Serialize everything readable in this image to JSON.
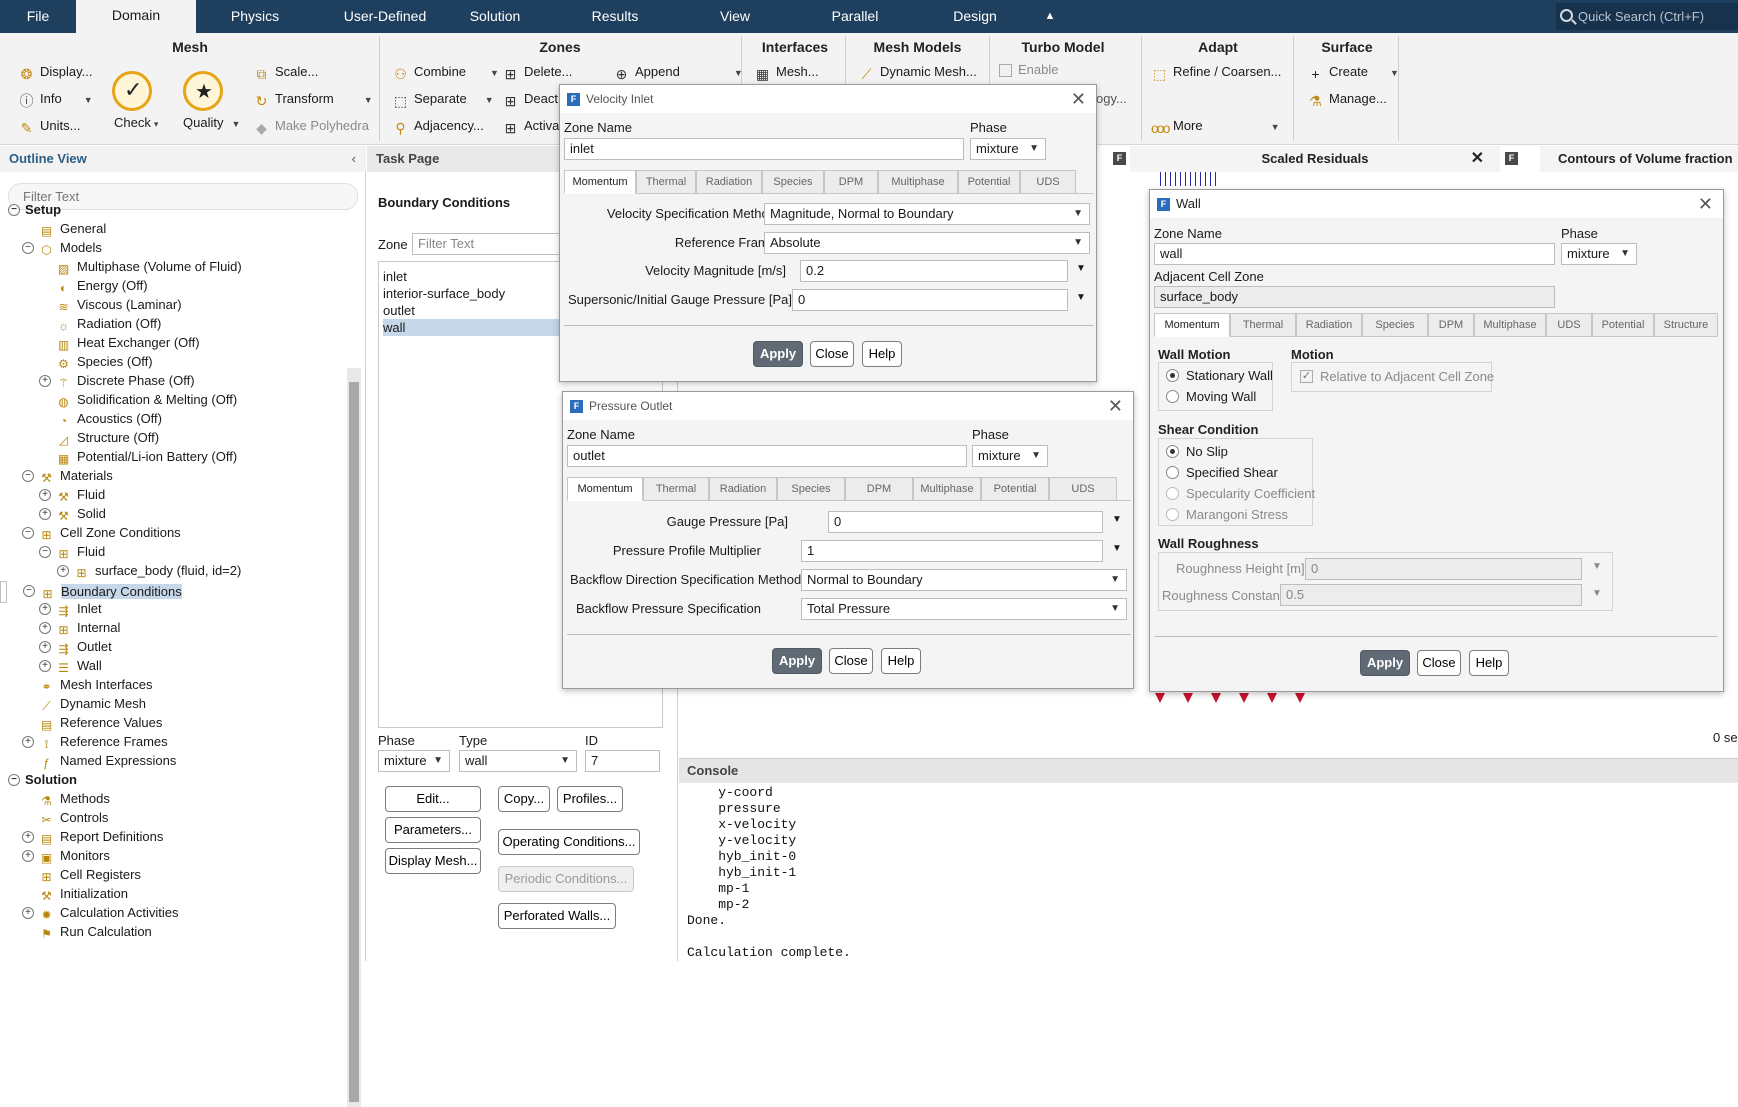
{
  "menubar": {
    "items": [
      "File",
      "Domain",
      "Physics",
      "User-Defined",
      "Solution",
      "Results",
      "View",
      "Parallel",
      "Design"
    ],
    "active": "Domain",
    "quick_search": "Quick Search (Ctrl+F)"
  },
  "ribbon": {
    "mesh": {
      "title": "Mesh",
      "display": "Display...",
      "info": "Info",
      "units": "Units...",
      "check": "Check",
      "quality": "Quality",
      "scale": "Scale...",
      "transform": "Transform",
      "make_polyhedra": "Make Polyhedra"
    },
    "zones": {
      "title": "Zones",
      "combine": "Combine",
      "separate": "Separate",
      "adjacency": "Adjacency...",
      "delete": "Delete...",
      "deact": "Deact",
      "activ": "Activa",
      "append": "Append"
    },
    "interfaces": {
      "title": "Interfaces",
      "mesh": "Mesh..."
    },
    "mesh_models": {
      "title": "Mesh Models",
      "dynamic_mesh": "Dynamic Mesh..."
    },
    "turbo_model": {
      "title": "Turbo Model",
      "enable": "Enable",
      "ogy": "ogy..."
    },
    "adapt": {
      "title": "Adapt",
      "refine": "Refine / Coarsen...",
      "more": "More"
    },
    "surface": {
      "title": "Surface",
      "create": "Create",
      "manage": "Manage..."
    }
  },
  "outline": {
    "title": "Outline View",
    "filter_placeholder": "Filter Text",
    "tree": [
      "Setup",
      "General",
      "Models",
      "Multiphase (Volume of Fluid)",
      "Energy (Off)",
      "Viscous (Laminar)",
      "Radiation (Off)",
      "Heat Exchanger (Off)",
      "Species (Off)",
      "Discrete Phase (Off)",
      "Solidification & Melting (Off)",
      "Acoustics (Off)",
      "Structure (Off)",
      "Potential/Li-ion Battery (Off)",
      "Materials",
      "Fluid",
      "Solid",
      "Cell Zone Conditions",
      "Fluid",
      "surface_body (fluid, id=2)",
      "Boundary Conditions",
      "Inlet",
      "Internal",
      "Outlet",
      "Wall",
      "Mesh Interfaces",
      "Dynamic Mesh",
      "Reference Values",
      "Reference Frames",
      "Named Expressions",
      "Solution",
      "Methods",
      "Controls",
      "Report Definitions",
      "Monitors",
      "Cell Registers",
      "Initialization",
      "Calculation Activities",
      "Run Calculation"
    ]
  },
  "task_page": {
    "title": "Task Page",
    "heading": "Boundary Conditions",
    "zone_label": "Zone",
    "zone_filter_placeholder": "Filter Text",
    "zones": [
      "inlet",
      "interior-surface_body",
      "outlet",
      "wall"
    ],
    "selected_zone": "wall",
    "phase_label": "Phase",
    "phase_value": "mixture",
    "type_label": "Type",
    "type_value": "wall",
    "id_label": "ID",
    "id_value": "7",
    "buttons": {
      "edit": "Edit...",
      "copy": "Copy...",
      "profiles": "Profiles...",
      "parameters": "Parameters...",
      "operating": "Operating Conditions...",
      "display_mesh": "Display Mesh...",
      "periodic": "Periodic Conditions...",
      "perforated": "Perforated Walls..."
    }
  },
  "graphics": {
    "tab1": "Scaled Residuals",
    "tab2": "Contours of Volume fraction",
    "time_fragment": "0 se"
  },
  "console": {
    "title": "Console",
    "lines": [
      "    y-coord",
      "    pressure",
      "    x-velocity",
      "    y-velocity",
      "    hyb_init-0",
      "    hyb_init-1",
      "    mp-1",
      "    mp-2",
      "Done.",
      "",
      "Calculation complete."
    ]
  },
  "velocity_inlet": {
    "title": "Velocity Inlet",
    "zone_name_label": "Zone Name",
    "zone_name": "inlet",
    "phase_label": "Phase",
    "phase": "mixture",
    "tabs": [
      "Momentum",
      "Thermal",
      "Radiation",
      "Species",
      "DPM",
      "Multiphase",
      "Potential",
      "UDS"
    ],
    "vel_spec_label": "Velocity Specification Method",
    "vel_spec": "Magnitude, Normal to Boundary",
    "ref_frame_label": "Reference Frame",
    "ref_frame": "Absolute",
    "vel_mag_label": "Velocity Magnitude [m/s]",
    "vel_mag": "0.2",
    "supersonic_label": "Supersonic/Initial Gauge Pressure [Pa]",
    "supersonic": "0",
    "apply": "Apply",
    "close": "Close",
    "help": "Help"
  },
  "pressure_outlet": {
    "title": "Pressure Outlet",
    "zone_name_label": "Zone Name",
    "zone_name": "outlet",
    "phase_label": "Phase",
    "phase": "mixture",
    "tabs": [
      "Momentum",
      "Thermal",
      "Radiation",
      "Species",
      "DPM",
      "Multiphase",
      "Potential",
      "UDS"
    ],
    "gauge_label": "Gauge Pressure [Pa]",
    "gauge": "0",
    "multiplier_label": "Pressure Profile Multiplier",
    "multiplier": "1",
    "backflow_dir_label": "Backflow Direction Specification Method",
    "backflow_dir": "Normal to Boundary",
    "backflow_press_label": "Backflow Pressure Specification",
    "backflow_press": "Total Pressure",
    "apply": "Apply",
    "close": "Close",
    "help": "Help"
  },
  "wall": {
    "title": "Wall",
    "zone_name_label": "Zone Name",
    "zone_name": "wall",
    "phase_label": "Phase",
    "phase": "mixture",
    "adjacent_label": "Adjacent Cell Zone",
    "adjacent": "surface_body",
    "tabs": [
      "Momentum",
      "Thermal",
      "Radiation",
      "Species",
      "DPM",
      "Multiphase",
      "UDS",
      "Potential",
      "Structure"
    ],
    "wall_motion_label": "Wall Motion",
    "stationary": "Stationary Wall",
    "moving": "Moving Wall",
    "motion_label": "Motion",
    "relative": "Relative to Adjacent Cell Zone",
    "shear_label": "Shear Condition",
    "no_slip": "No Slip",
    "specified_shear": "Specified Shear",
    "specularity": "Specularity Coefficient",
    "marangoni": "Marangoni Stress",
    "roughness_label": "Wall Roughness",
    "rough_height_label": "Roughness Height [m]",
    "rough_height": "0",
    "rough_const_label": "Roughness Constant",
    "rough_const": "0.5",
    "apply": "Apply",
    "close": "Close",
    "help": "Help"
  }
}
